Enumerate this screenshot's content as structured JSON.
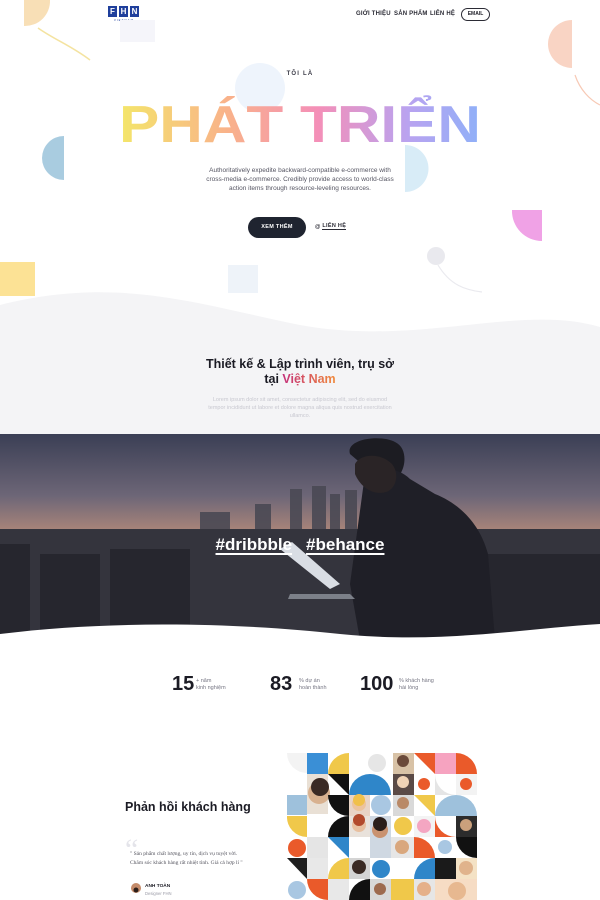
{
  "header": {
    "logo_letters": [
      "F",
      "H",
      "N"
    ],
    "logo_sub": "VIETNAM",
    "nav": [
      "GIỚI THIỆU",
      "SẢN PHẨM",
      "LIÊN HỆ"
    ],
    "email_button": "EMAIL"
  },
  "hero": {
    "eyebrow": "TÔI LÀ",
    "title": "PHÁT TRIỂN",
    "description": "Authoritatively expedite backward-compatible e-commerce with cross-media e-commerce. Credibly provide access to world-class action items through resource-leveling resources.",
    "primary_button": "XEM THÊM",
    "link_button": "LIÊN HỆ",
    "link_icon": "at-icon"
  },
  "about": {
    "title_prefix": "Thiết kế & Lập trình viên, trụ sở tại ",
    "title_highlight": "Việt Nam",
    "description": "Lorem ipsum dolor sit amet, consectetur adipiscing elit, sed do eiusmod tempor incididunt ut labore et dolore magna aliqua quis nostrud exercitation ullamco."
  },
  "social_tags": [
    "#dribbble",
    "#behance"
  ],
  "stats": [
    {
      "number": "15",
      "label_line1": "+ năm",
      "label_line2": "kinh nghiệm"
    },
    {
      "number": "83",
      "label_line1": "% dự án",
      "label_line2": "hoàn thành"
    },
    {
      "number": "100",
      "label_line1": "% khách hàng",
      "label_line2": "hài lòng"
    }
  ],
  "testimonials": {
    "title": "Phản hồi khách hàng",
    "quote": "\" Sản phẩm chất lượng, uy tín, dịch vụ tuyệt vời. Chăm sóc khách hàng rất nhiệt tình. Giá cả hợp lí \"",
    "author_name": "ANH TOÀN",
    "author_role": "Designer FHN"
  },
  "colors": {
    "dark": "#1f2430",
    "logo_blue": "#1f3f9c",
    "gradient": [
      "#f4e66a",
      "#f9b28a",
      "#f48fb8",
      "#b9a3f0",
      "#8fb0f8"
    ],
    "highlight": [
      "#c42f7a",
      "#f18a3a"
    ]
  }
}
